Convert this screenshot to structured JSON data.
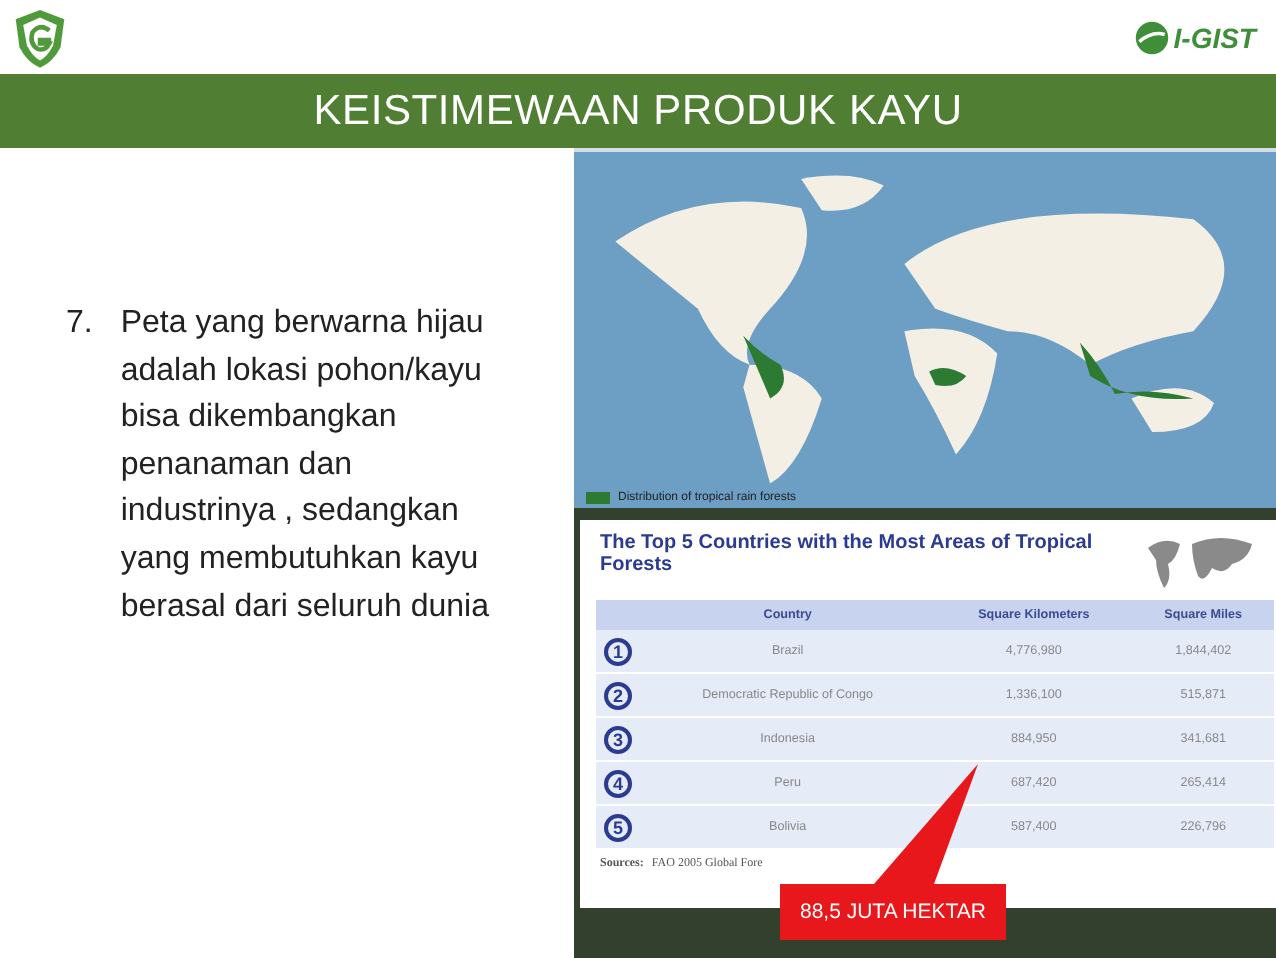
{
  "header": {
    "title": "KEISTIMEWAAN PRODUK KAYU",
    "logo_text": "I-GIST"
  },
  "point": {
    "number": "7.",
    "text": "Peta yang berwarna hijau adalah lokasi pohon/kayu bisa dikembangkan penanaman dan industrinya , sedangkan yang membutuhkan kayu berasal dari seluruh dunia"
  },
  "map": {
    "legend": "Distribution of tropical rain forests"
  },
  "table": {
    "title": "The Top 5 Countries with the Most Areas of Tropical Forests",
    "columns": [
      "Country",
      "Square Kilometers",
      "Square Miles"
    ],
    "rows": [
      {
        "rank": "1",
        "cells": [
          "Brazil",
          "4,776,980",
          "1,844,402"
        ]
      },
      {
        "rank": "2",
        "cells": [
          "Democratic Republic of Congo",
          "1,336,100",
          "515,871"
        ]
      },
      {
        "rank": "3",
        "cells": [
          "Indonesia",
          "884,950",
          "341,681"
        ]
      },
      {
        "rank": "4",
        "cells": [
          "Peru",
          "687,420",
          "265,414"
        ]
      },
      {
        "rank": "5",
        "cells": [
          "Bolivia",
          "587,400",
          "226,796"
        ]
      }
    ],
    "source_label": "Sources:",
    "source_text": "FAO 2005 Global Fore"
  },
  "callout": {
    "text": "88,5 JUTA HEKTAR"
  }
}
